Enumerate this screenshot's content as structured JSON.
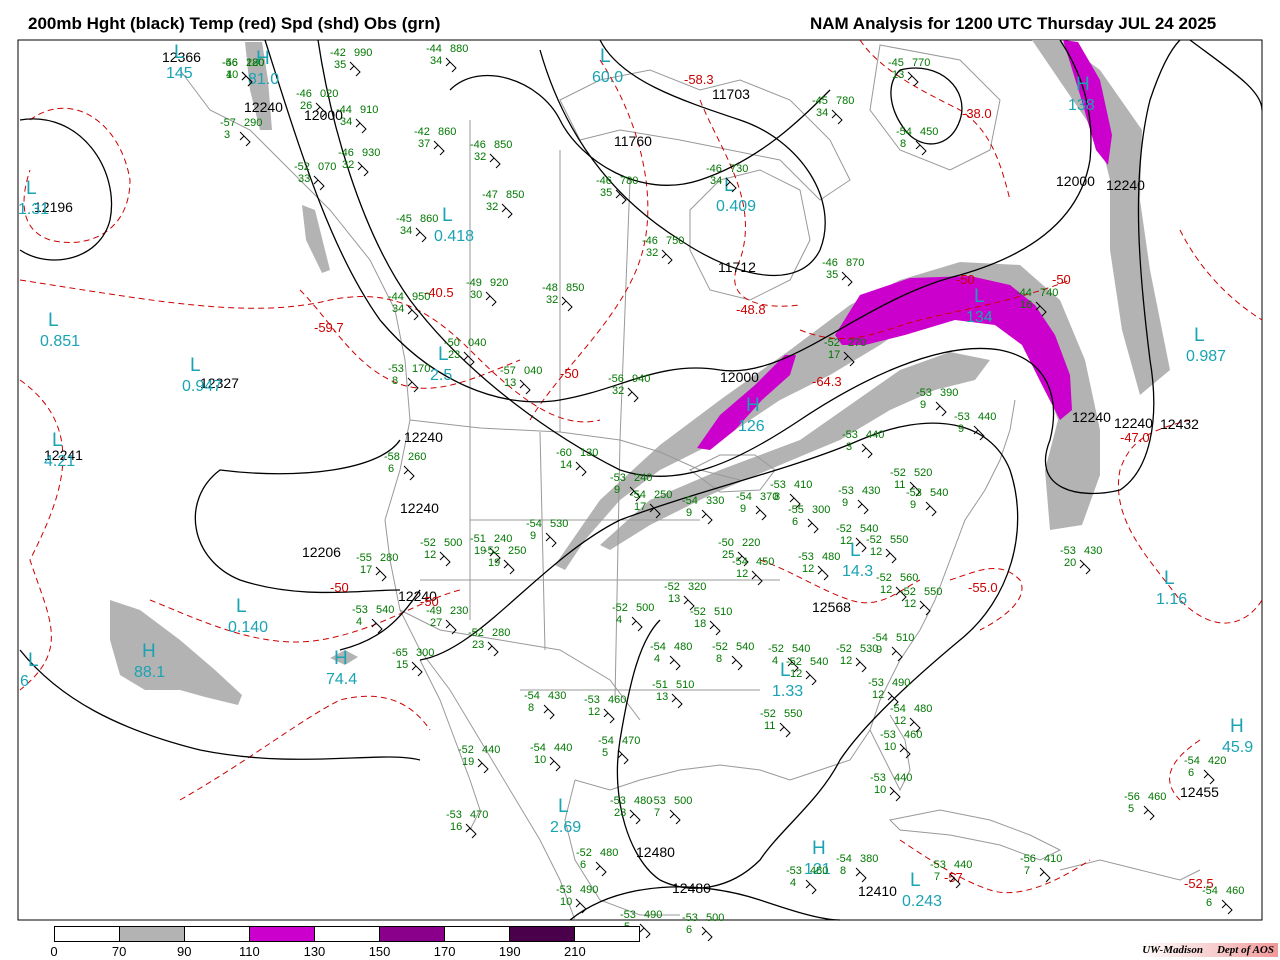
{
  "header": {
    "left_title": "200mb Hght (black) Temp (red) Spd (shd) Obs (grn)",
    "right_title": "NAM Analysis for 1200 UTC Thursday  JUL 24 2025"
  },
  "colors": {
    "height_contour": "#000000",
    "temp_contour": "#cc0000",
    "speed_70_90": "#b3b3b3",
    "speed_110_130": "#cc00cc",
    "speed_150_170": "#8b008b",
    "speed_190_210": "#4b004b",
    "obs": "#007700",
    "low_high_cyan": "#1aa3b3",
    "map_lines": "#999999"
  },
  "legend": {
    "ticks": [
      "0",
      "70",
      "90",
      "110",
      "130",
      "150",
      "170",
      "190",
      "210"
    ],
    "fills": [
      "#ffffff",
      "#b3b3b3",
      "#ffffff",
      "#cc00cc",
      "#ffffff",
      "#8b008b",
      "#ffffff",
      "#4b004b",
      "#ffffff"
    ]
  },
  "credit": {
    "org": "UW-Madison",
    "dept": "Dept of AOS"
  },
  "height_labels": [
    "12366",
    "12240",
    "12000",
    "12196",
    "12327",
    "12241",
    "12240",
    "12240",
    "12206",
    "12240",
    "11703",
    "11760",
    "11712",
    "12000",
    "12000",
    "12240",
    "12240",
    "12240",
    "12432",
    "12568",
    "12455",
    "12480",
    "12480",
    "12410"
  ],
  "lows_highs": [
    {
      "s": "L",
      "v": "145"
    },
    {
      "s": "H",
      "v": "81.0"
    },
    {
      "s": "L",
      "v": "1.31"
    },
    {
      "s": "L",
      "v": "0.851"
    },
    {
      "s": "L",
      "v": "0.947"
    },
    {
      "s": "L",
      "v": "4.21"
    },
    {
      "s": "L",
      "v": "0.418"
    },
    {
      "s": "L",
      "v": "2.5"
    },
    {
      "s": "L",
      "v": "60.0"
    },
    {
      "s": "L",
      "v": "0.409"
    },
    {
      "s": "H",
      "v": "126"
    },
    {
      "s": "L",
      "v": "0.140"
    },
    {
      "s": "H",
      "v": "88.1"
    },
    {
      "s": "H",
      "v": "74.4"
    },
    {
      "s": "L",
      "v": "2.69"
    },
    {
      "s": "L",
      "v": "1.33"
    },
    {
      "s": "L",
      "v": "14.3"
    },
    {
      "s": "L",
      "v": "1.16"
    },
    {
      "s": "L",
      "v": "0.987"
    },
    {
      "s": "H",
      "v": "45.9"
    },
    {
      "s": "H",
      "v": "121"
    },
    {
      "s": "L",
      "v": "0.243"
    },
    {
      "s": "H",
      "v": "138"
    },
    {
      "s": "L",
      "v": "134"
    },
    {
      "s": "L",
      "v": "6"
    }
  ],
  "temp_labels": [
    "-59.7",
    "-40.5",
    "-58.3",
    "-38.0",
    "-48.8",
    "-64.3",
    "-50",
    "-50",
    "-50",
    "-50",
    "-50",
    "-47.0",
    "-55.0",
    "-52.5",
    "-57"
  ],
  "obs": [
    {
      "t": "-56",
      "h": "280",
      "d": "4"
    },
    {
      "t": "-42",
      "h": "990",
      "d": "35"
    },
    {
      "t": "-44",
      "h": "880",
      "d": "34"
    },
    {
      "t": "-46",
      "h": "020",
      "d": "26"
    },
    {
      "t": "-57",
      "h": "290",
      "d": "3"
    },
    {
      "t": "-44",
      "h": "910",
      "d": "34"
    },
    {
      "t": "-42",
      "h": "860",
      "d": "37"
    },
    {
      "t": "-46",
      "h": "930",
      "d": "32"
    },
    {
      "t": "-52",
      "h": "070",
      "d": "33"
    },
    {
      "t": "-46",
      "h": "850",
      "d": "32"
    },
    {
      "t": "-47",
      "h": "850",
      "d": "32"
    },
    {
      "t": "-46",
      "h": "780",
      "d": "35"
    },
    {
      "t": "-46",
      "h": "730",
      "d": "34"
    },
    {
      "t": "-45",
      "h": "770",
      "d": "13"
    },
    {
      "t": "-45",
      "h": "780",
      "d": "34"
    },
    {
      "t": "-45",
      "h": "860",
      "d": "34"
    },
    {
      "t": "-46",
      "h": "750",
      "d": "32"
    },
    {
      "t": "-49",
      "h": "920",
      "d": "30"
    },
    {
      "t": "-48",
      "h": "850",
      "d": "32"
    },
    {
      "t": "-46",
      "h": "870",
      "d": "35"
    },
    {
      "t": "-44",
      "h": "950",
      "d": "34"
    },
    {
      "t": "-50",
      "h": "040",
      "d": "23"
    },
    {
      "t": "-53",
      "h": "170",
      "d": "8"
    },
    {
      "t": "-57",
      "h": "040",
      "d": "13"
    },
    {
      "t": "-56",
      "h": "940",
      "d": "32"
    },
    {
      "t": "-52",
      "h": "270",
      "d": "17"
    },
    {
      "t": "-53",
      "h": "390",
      "d": "9"
    },
    {
      "t": "-53",
      "h": "440",
      "d": "9"
    },
    {
      "t": "-53",
      "h": "440",
      "d": "3"
    },
    {
      "t": "-58",
      "h": "260",
      "d": "6"
    },
    {
      "t": "-60",
      "h": "130",
      "d": "14"
    },
    {
      "t": "-53",
      "h": "240",
      "d": "9"
    },
    {
      "t": "-54",
      "h": "250",
      "d": "17"
    },
    {
      "t": "-54",
      "h": "330",
      "d": "9"
    },
    {
      "t": "-54",
      "h": "370",
      "d": "9"
    },
    {
      "t": "-53",
      "h": "410",
      "d": "8"
    },
    {
      "t": "-53",
      "h": "430",
      "d": "9"
    },
    {
      "t": "-52",
      "h": "520",
      "d": "11"
    },
    {
      "t": "-53",
      "h": "540",
      "d": "9"
    },
    {
      "t": "-54",
      "h": "530",
      "d": "9"
    },
    {
      "t": "-55",
      "h": "300",
      "d": "6"
    },
    {
      "t": "-52",
      "h": "500",
      "d": "12"
    },
    {
      "t": "-51",
      "h": "240",
      "d": "19"
    },
    {
      "t": "-52",
      "h": "250",
      "d": "19"
    },
    {
      "t": "-55",
      "h": "280",
      "d": "17"
    },
    {
      "t": "-50",
      "h": "220",
      "d": "25"
    },
    {
      "t": "-54",
      "h": "450",
      "d": "12"
    },
    {
      "t": "-53",
      "h": "480",
      "d": "12"
    },
    {
      "t": "-52",
      "h": "540",
      "d": "12"
    },
    {
      "t": "-52",
      "h": "550",
      "d": "12"
    },
    {
      "t": "-52",
      "h": "560",
      "d": "12"
    },
    {
      "t": "-52",
      "h": "550",
      "d": "12"
    },
    {
      "t": "-53",
      "h": "540",
      "d": "4"
    },
    {
      "t": "-49",
      "h": "230",
      "d": "27"
    },
    {
      "t": "-52",
      "h": "280",
      "d": "23"
    },
    {
      "t": "-52",
      "h": "320",
      "d": "13"
    },
    {
      "t": "-52",
      "h": "500",
      "d": "4"
    },
    {
      "t": "-54",
      "h": "480",
      "d": "4"
    },
    {
      "t": "-52",
      "h": "510",
      "d": "18"
    },
    {
      "t": "-52",
      "h": "540",
      "d": "8"
    },
    {
      "t": "-52",
      "h": "530",
      "d": "12"
    },
    {
      "t": "-52",
      "h": "540",
      "d": "4"
    },
    {
      "t": "-52",
      "h": "540",
      "d": "12"
    },
    {
      "t": "-54",
      "h": "510",
      "d": "9"
    },
    {
      "t": "-65",
      "h": "300",
      "d": "15"
    },
    {
      "t": "-54",
      "h": "430",
      "d": "8"
    },
    {
      "t": "-53",
      "h": "460",
      "d": "12"
    },
    {
      "t": "-51",
      "h": "510",
      "d": "13"
    },
    {
      "t": "-52",
      "h": "550",
      "d": "11"
    },
    {
      "t": "-53",
      "h": "490",
      "d": "12"
    },
    {
      "t": "-54",
      "h": "480",
      "d": "12"
    },
    {
      "t": "-54",
      "h": "470",
      "d": "5"
    },
    {
      "t": "-52",
      "h": "440",
      "d": "19"
    },
    {
      "t": "-54",
      "h": "440",
      "d": "10"
    },
    {
      "t": "-53",
      "h": "460",
      "d": "10"
    },
    {
      "t": "-53",
      "h": "440",
      "d": "10"
    },
    {
      "t": "-53",
      "h": "430",
      "d": "20"
    },
    {
      "t": "-53",
      "h": "480",
      "d": "23"
    },
    {
      "t": "-53",
      "h": "500",
      "d": "7"
    },
    {
      "t": "-53",
      "h": "470",
      "d": "16"
    },
    {
      "t": "-52",
      "h": "480",
      "d": "6"
    },
    {
      "t": "-53",
      "h": "490",
      "d": "10"
    },
    {
      "t": "-53",
      "h": "490",
      "d": "5"
    },
    {
      "t": "-53",
      "h": "500",
      "d": "6"
    },
    {
      "t": "-53",
      "h": "480",
      "d": "4"
    },
    {
      "t": "-54",
      "h": "380",
      "d": "8"
    },
    {
      "t": "-53",
      "h": "440",
      "d": "7"
    },
    {
      "t": "-56",
      "h": "410",
      "d": "7"
    },
    {
      "t": "-54",
      "h": "420",
      "d": "6"
    },
    {
      "t": "-56",
      "h": "460",
      "d": "5"
    },
    {
      "t": "-54",
      "h": "460",
      "d": "6"
    },
    {
      "t": "-54",
      "h": "450",
      "d": "8"
    },
    {
      "t": "-44",
      "h": "740",
      "d": "16"
    },
    {
      "t": "-46",
      "h": "120",
      "d": "10"
    }
  ]
}
